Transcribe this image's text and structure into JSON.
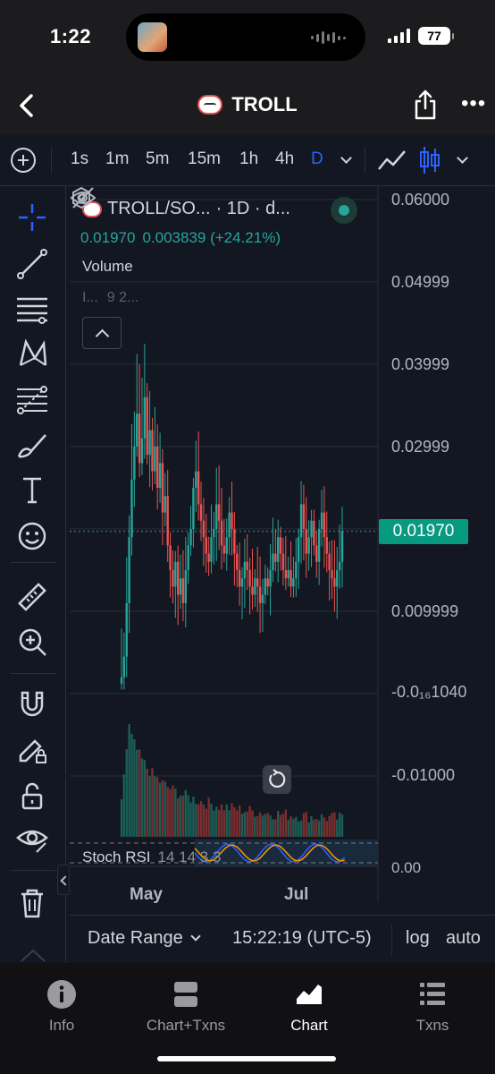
{
  "status_bar": {
    "time": "1:22",
    "battery": "77",
    "icons": [
      "media-thumbnail-icon",
      "audio-wave-icon",
      "signal-icon",
      "battery-icon"
    ]
  },
  "header": {
    "title": "TROLL",
    "icons": [
      "back-chevron-icon",
      "troll-face-icon",
      "share-icon",
      "more-icon"
    ]
  },
  "timeframes": {
    "items": [
      "1s",
      "1m",
      "5m",
      "15m",
      "1h",
      "4h",
      "D"
    ],
    "active": "D",
    "icons": [
      "add-circle-icon",
      "chevron-down-icon",
      "line-chart-icon",
      "candles-icon",
      "chevron-down-icon"
    ]
  },
  "left_tools": [
    "crosshair-icon",
    "trend-line-icon",
    "horizontal-lines-icon",
    "pattern-icon",
    "fib-retracement-icon",
    "brush-icon",
    "text-icon",
    "emoji-icon",
    "ruler-icon",
    "zoom-in-icon",
    "magnet-icon",
    "pencil-lock-icon",
    "unlock-icon",
    "eye-icon",
    "trash-icon"
  ],
  "legend": {
    "symbol": "TROLL/SO...",
    "interval": "· 1D · d...",
    "last": "0.01970",
    "change": "0.003839 (+24.21%)",
    "volume_label": "Volume",
    "volume_params": [
      "I...",
      "9 2..."
    ]
  },
  "y_axis": {
    "labels": [
      "0.06000",
      "0.04999",
      "0.03999",
      "0.02999",
      "0.009999",
      "-0.0₁₆1040",
      "-0.01000"
    ],
    "current_price": "0.01970"
  },
  "x_axis": {
    "labels": [
      "May",
      "Jul"
    ]
  },
  "stoch_rsi": {
    "label": "Stoch RSI",
    "params": "14 14 3 3",
    "axis_value": "0.00"
  },
  "bottom_controls": {
    "date_range": "Date Range",
    "clock": "15:22:19 (UTC-5)",
    "log": "log",
    "auto": "auto"
  },
  "tab_bar": {
    "tabs": [
      {
        "label": "Info",
        "icon": "info-icon"
      },
      {
        "label": "Chart+Txns",
        "icon": "split-view-icon"
      },
      {
        "label": "Chart",
        "icon": "area-chart-icon"
      },
      {
        "label": "Txns",
        "icon": "list-icon"
      }
    ],
    "active": "Chart"
  },
  "colors": {
    "up": "#26a69a",
    "down": "#ef5350",
    "accent": "#2962ff",
    "price_tag": "#089981",
    "background": "#131722"
  },
  "chart_data": {
    "type": "candlestick",
    "interval": "1D",
    "ylim": [
      -0.015,
      0.06
    ],
    "price_series_description": "daily OHLC, values estimated from axis",
    "close_series": [
      0.002,
      0.0045,
      0.011,
      0.019,
      0.026,
      0.03,
      0.034,
      0.028,
      0.031,
      0.036,
      0.029,
      0.032,
      0.027,
      0.03,
      0.025,
      0.028,
      0.022,
      0.024,
      0.018,
      0.015,
      0.013,
      0.016,
      0.012,
      0.014,
      0.011,
      0.015,
      0.018,
      0.02,
      0.025,
      0.027,
      0.023,
      0.021,
      0.019,
      0.017,
      0.016,
      0.019,
      0.02,
      0.023,
      0.021,
      0.018,
      0.017,
      0.019,
      0.022,
      0.02,
      0.017,
      0.015,
      0.013,
      0.014,
      0.016,
      0.015,
      0.013,
      0.012,
      0.014,
      0.013,
      0.011,
      0.012,
      0.014,
      0.013,
      0.015,
      0.017,
      0.016,
      0.019,
      0.017,
      0.015,
      0.014,
      0.015,
      0.013,
      0.014,
      0.016,
      0.019,
      0.023,
      0.02,
      0.017,
      0.019,
      0.021,
      0.018,
      0.016,
      0.02,
      0.022,
      0.019,
      0.017,
      0.015,
      0.014,
      0.013,
      0.015,
      0.016,
      0.0197
    ]
  }
}
